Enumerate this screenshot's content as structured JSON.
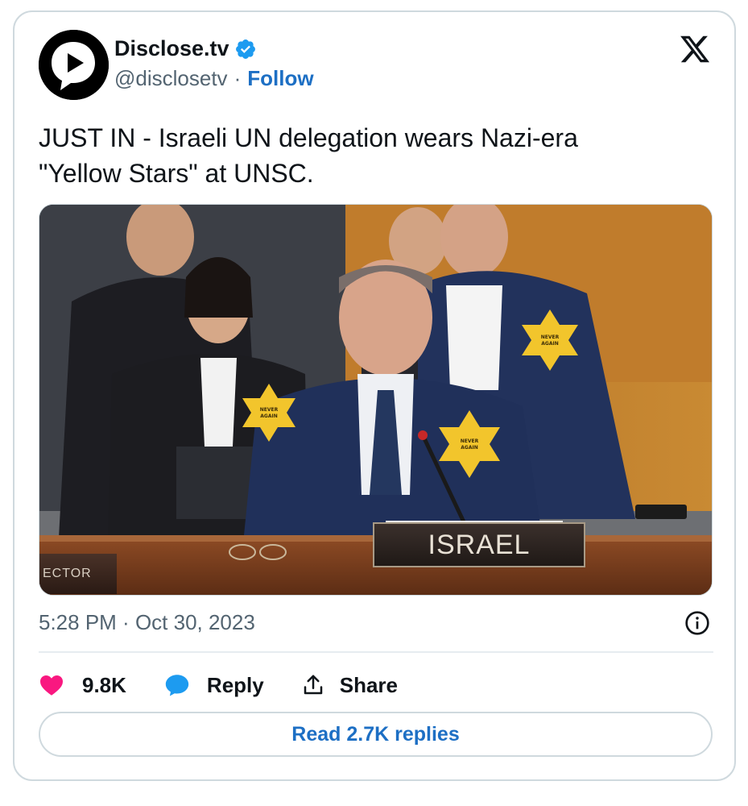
{
  "author": {
    "display_name": "Disclose.tv",
    "handle": "@disclosetv",
    "separator": "·",
    "follow_label": "Follow",
    "avatar_icon": "disclose-play-logo-icon",
    "verified_icon": "verified-badge-icon"
  },
  "platform_icon": "x-logo-icon",
  "tweet": {
    "line1": "JUST IN - Israeli UN delegation wears Nazi-era",
    "line2": "\"Yellow Stars\" at UNSC."
  },
  "media": {
    "nameplate": "ISRAEL",
    "side_nameplate": "ECTOR",
    "badge_text_1": "NEVER",
    "badge_text_2": "AGAIN"
  },
  "meta": {
    "time": "5:28 PM",
    "separator": " · ",
    "date": "Oct 30, 2023",
    "info_icon": "info-icon"
  },
  "actions": {
    "like_count": "9.8K",
    "reply_label": "Reply",
    "share_label": "Share"
  },
  "read_replies_label": "Read 2.7K replies",
  "colors": {
    "link_blue": "#1d6fc4",
    "verified_blue": "#1d9bf0",
    "like_pink": "#f91880",
    "muted_text": "#536471",
    "border": "#cfd9de"
  }
}
